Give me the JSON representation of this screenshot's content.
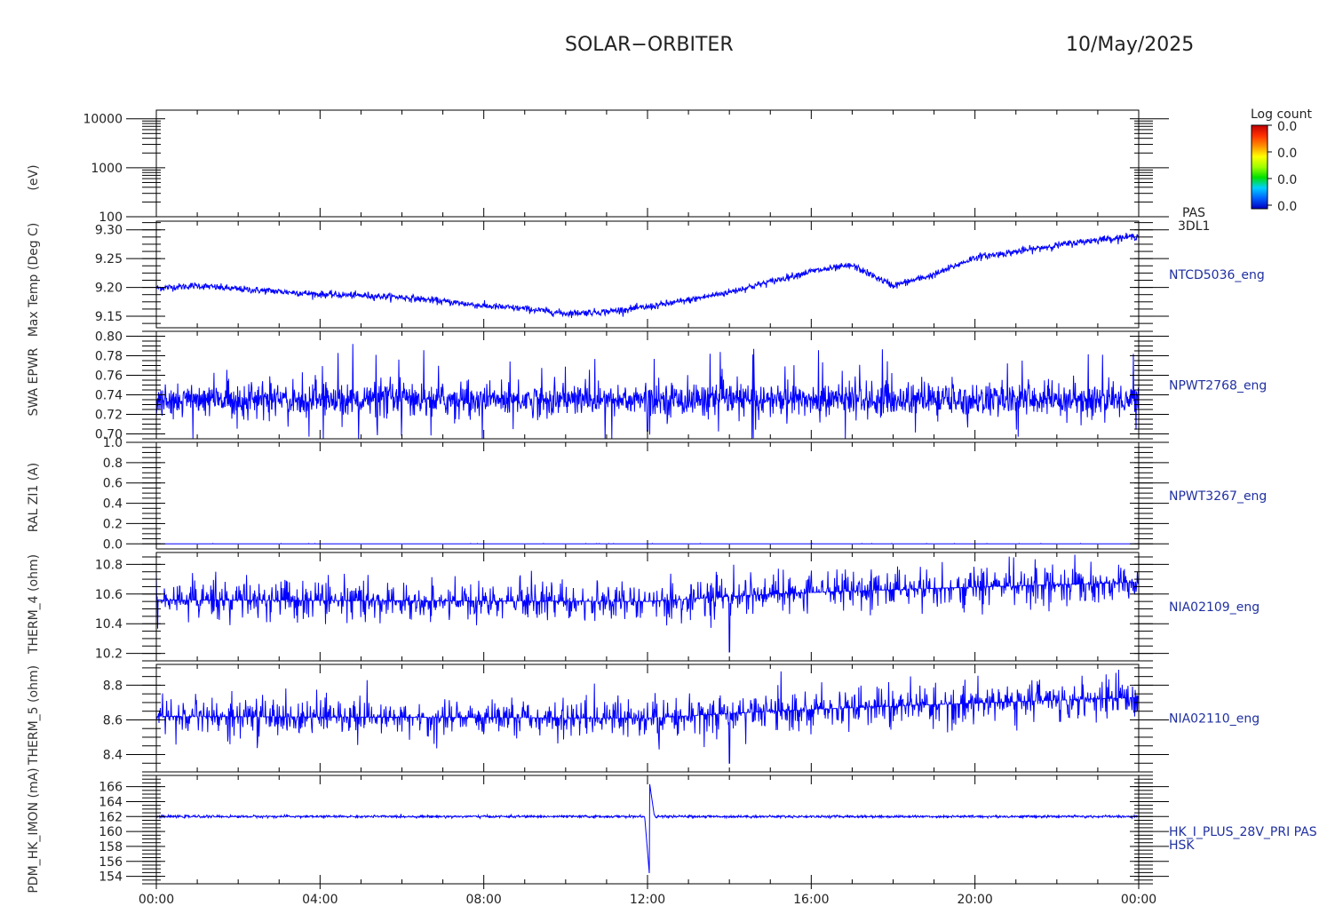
{
  "header": {
    "title": "SOLAR−ORBITER",
    "date": "10/May/2025"
  },
  "colorbar": {
    "label": "Log count",
    "ticks": [
      "0.0",
      "0.0",
      "0.0",
      "0.0"
    ],
    "colors": [
      "#c00000",
      "#ff3000",
      "#ff9000",
      "#ffff00",
      "#a0ff00",
      "#00e000",
      "#00d0ff",
      "#0060ff",
      "#0000c0"
    ]
  },
  "line_color": "#0000ff",
  "label_color": "#2030a0",
  "chart_data": [
    {
      "type": "heatmap",
      "panel_label": "PAS\n3DL1",
      "ylabel": "(eV)",
      "yscale": "log",
      "ylim": [
        100,
        15000
      ],
      "yticks": [
        100,
        1000,
        10000
      ],
      "ytick_labels": [
        "100",
        "1000",
        "10000"
      ],
      "values": []
    },
    {
      "type": "line",
      "panel_label": "NTCD5036_eng",
      "ylabel": "Max Temp (Deg C)",
      "ylim": [
        9.13,
        9.315
      ],
      "yticks": [
        9.15,
        9.2,
        9.25,
        9.3
      ],
      "ytick_labels": [
        "9.15",
        "9.20",
        "9.25",
        "9.30"
      ],
      "x_hours": [
        0,
        1,
        2,
        3,
        4,
        5,
        6,
        7,
        8,
        9,
        10,
        11,
        12,
        13,
        14,
        15,
        16,
        17,
        18,
        19,
        20,
        21,
        22,
        23,
        24
      ],
      "values": [
        9.199,
        9.203,
        9.197,
        9.193,
        9.188,
        9.186,
        9.183,
        9.176,
        9.168,
        9.163,
        9.155,
        9.158,
        9.166,
        9.178,
        9.192,
        9.21,
        9.228,
        9.238,
        9.203,
        9.222,
        9.252,
        9.262,
        9.273,
        9.283,
        9.289
      ],
      "noise": 0.003
    },
    {
      "type": "line",
      "panel_label": "NPWT2768_eng",
      "ylabel": "SWA EPWR",
      "ylim": [
        0.695,
        0.805
      ],
      "yticks": [
        0.7,
        0.72,
        0.74,
        0.76,
        0.78,
        0.8
      ],
      "ytick_labels": [
        "0.70",
        "0.72",
        "0.74",
        "0.76",
        "0.78",
        "0.80"
      ],
      "baseline": 0.735,
      "spread": 0.015,
      "min": 0.703,
      "max": 0.792
    },
    {
      "type": "line",
      "panel_label": "NPWT3267_eng",
      "ylabel": "RAL ZI1 (A)",
      "ylim": [
        -0.05,
        1.0
      ],
      "yticks": [
        0.0,
        0.2,
        0.4,
        0.6,
        0.8,
        1.0
      ],
      "ytick_labels": [
        "0.0",
        "0.2",
        "0.4",
        "0.6",
        "0.8",
        "1.0"
      ],
      "baseline": 0.0
    },
    {
      "type": "line",
      "panel_label": "NIA02109_eng",
      "ylabel": "THERM_4 (ohm)",
      "ylim": [
        10.15,
        10.88
      ],
      "yticks": [
        10.2,
        10.4,
        10.6,
        10.8
      ],
      "ytick_labels": [
        "10.2",
        "10.4",
        "10.6",
        "10.8"
      ],
      "x_hours": [
        0,
        12,
        15,
        18,
        24
      ],
      "values": [
        10.56,
        10.55,
        10.6,
        10.63,
        10.68
      ],
      "spread": 0.07,
      "min": 10.21,
      "max": 10.85
    },
    {
      "type": "line",
      "panel_label": "NIA02110_eng",
      "ylabel": "THERM_5 (ohm)",
      "ylim": [
        8.3,
        8.92
      ],
      "yticks": [
        8.4,
        8.6,
        8.8
      ],
      "ytick_labels": [
        "8.4",
        "8.6",
        "8.8"
      ],
      "x_hours": [
        0,
        12,
        15,
        18,
        24
      ],
      "values": [
        8.62,
        8.61,
        8.65,
        8.68,
        8.73
      ],
      "spread": 0.06,
      "min": 8.35,
      "max": 8.91
    },
    {
      "type": "line",
      "panel_label": "HK_I_PLUS_28V_PRI PAS\nHSK",
      "ylabel": "PDM_HK_IMON (mA)",
      "ylim": [
        153.0,
        167.5
      ],
      "yticks": [
        154,
        156,
        158,
        160,
        162,
        164,
        166
      ],
      "ytick_labels": [
        "154",
        "156",
        "158",
        "160",
        "162",
        "164",
        "166"
      ],
      "baseline": 162.0,
      "spike_hour": 12.05,
      "spike_min": 154.0,
      "spike_max": 166.5
    }
  ],
  "xaxis": {
    "xlim": [
      0,
      24
    ],
    "ticks": [
      0,
      4,
      8,
      12,
      16,
      20,
      24
    ],
    "tick_labels": [
      "00:00",
      "04:00",
      "08:00",
      "12:00",
      "16:00",
      "20:00",
      "00:00"
    ]
  }
}
